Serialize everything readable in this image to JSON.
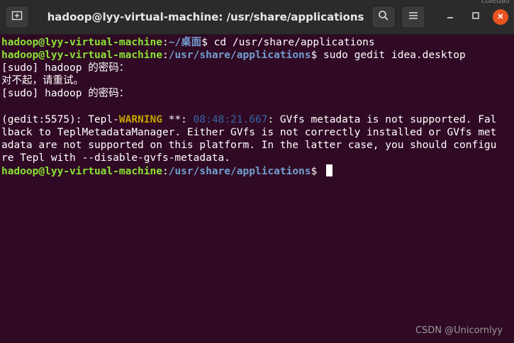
{
  "window": {
    "title": "hadoop@lyy-virtual-machine: /usr/share/applications",
    "corner_text": "ctaedao",
    "buttons": {
      "new_tab_icon": "new-tab-icon",
      "search_icon": "search-icon",
      "menu_icon": "hamburger-menu-icon",
      "minimize_icon": "minimize-icon",
      "maximize_icon": "maximize-icon",
      "close_icon": "close-icon"
    }
  },
  "terminal": {
    "line1": {
      "user": "hadoop@lyy-virtual-machine",
      "sep": ":",
      "path": "~/桌面",
      "prompt": "$ ",
      "command": "cd /usr/share/applications"
    },
    "line2": {
      "user": "hadoop@lyy-virtual-machine",
      "sep": ":",
      "path": "/usr/share/applications",
      "prompt": "$ ",
      "command": "sudo gedit idea.desktop"
    },
    "line3": "[sudo] hadoop 的密码：",
    "line4": "对不起，请重试。",
    "line5": "[sudo] hadoop 的密码：",
    "line6": "",
    "line7": {
      "prefix": "(gedit:5575): Tepl-",
      "level": "WARNING",
      "mid": " **: ",
      "time": "08:48:21.667",
      "msg": ": GVfs metadata is not supported. Fal"
    },
    "line8": "lback to TeplMetadataManager. Either GVfs is not correctly installed or GVfs met",
    "line9": "adata are not supported on this platform. In the latter case, you should configu",
    "line10": "re Tepl with --disable-gvfs-metadata.",
    "line11": {
      "user": "hadoop@lyy-virtual-machine",
      "sep": ":",
      "path": "/usr/share/applications",
      "prompt": "$ "
    }
  },
  "watermark": "CSDN @Unicornlyy",
  "colors": {
    "background": "#300a24",
    "user": "#8ae234",
    "path": "#729fcf",
    "warning": "#c4a000",
    "timestamp": "#3465a4",
    "close_button": "#e95420"
  }
}
